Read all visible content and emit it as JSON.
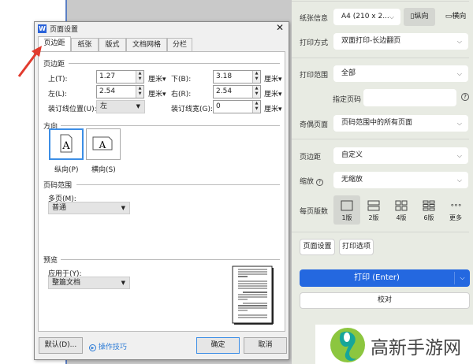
{
  "dialog": {
    "title": "页面设置",
    "app_icon": "W",
    "tabs": [
      {
        "label": "页边距"
      },
      {
        "label": "纸张"
      },
      {
        "label": "版式"
      },
      {
        "label": "文档网格"
      },
      {
        "label": "分栏"
      }
    ],
    "margins": {
      "section": "页边距",
      "top_label": "上(T):",
      "top": "1.27",
      "bottom_label": "下(B):",
      "bottom": "3.18",
      "left_label": "左(L):",
      "left": "2.54",
      "right_label": "右(R):",
      "right": "2.54",
      "gutter_pos_label": "装订线位置(U):",
      "gutter_pos": "左",
      "gutter_label": "装订线宽(G):",
      "gutter": "0",
      "unit": "厘米"
    },
    "orientation": {
      "section": "方向",
      "portrait": "纵向(P)",
      "landscape": "横向(S)",
      "selected": "portrait"
    },
    "pages": {
      "section": "页码范围",
      "multi_label": "多页(M):",
      "multi": "普通"
    },
    "preview": {
      "section": "预览",
      "apply_label": "应用于(Y):",
      "apply": "整篇文档"
    },
    "buttons": {
      "default": "默认(D)...",
      "tips": "操作技巧",
      "ok": "确定",
      "cancel": "取消"
    }
  },
  "panel": {
    "paper_label": "纸张信息",
    "paper": "A4 (210 x 2...",
    "portrait": "纵向",
    "landscape": "横向",
    "mode_label": "打印方式",
    "mode": "双面打印-长边翻页",
    "range_label": "打印范围",
    "range": "全部",
    "pages_label": "指定页码",
    "pages_value": "",
    "odd_label": "奇偶页面",
    "odd": "页码范围中的所有页面",
    "margin_label": "页边距",
    "margin": "自定义",
    "zoom_label": "缩放",
    "zoom": "无缩放",
    "perpage_label": "每页版数",
    "perpage_options": [
      {
        "label": "1版"
      },
      {
        "label": "2版"
      },
      {
        "label": "4版"
      },
      {
        "label": "6版"
      },
      {
        "label": "更多"
      }
    ],
    "perpage_selected": "1版",
    "page_setup": "页面设置",
    "print_options": "打印选项",
    "print": "打印 (Enter)",
    "proof": "校对",
    "accent": "#2468e0"
  },
  "logo": {
    "text": "高新手游网"
  }
}
